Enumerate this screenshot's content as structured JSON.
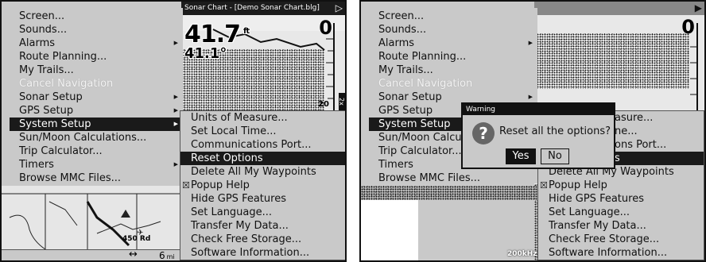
{
  "main_menu": [
    {
      "label": "Screen...",
      "arrow": false,
      "state": "normal"
    },
    {
      "label": "Sounds...",
      "arrow": false,
      "state": "normal"
    },
    {
      "label": "Alarms",
      "arrow": true,
      "state": "normal"
    },
    {
      "label": "Route Planning...",
      "arrow": false,
      "state": "normal"
    },
    {
      "label": "My Trails...",
      "arrow": false,
      "state": "normal"
    },
    {
      "label": "Cancel Navigation",
      "arrow": false,
      "state": "disabled"
    },
    {
      "label": "Sonar Setup",
      "arrow": true,
      "state": "normal"
    },
    {
      "label": "GPS Setup",
      "arrow": true,
      "state": "normal"
    },
    {
      "label": "System Setup",
      "arrow": true,
      "state": "selected"
    },
    {
      "label": "Sun/Moon Calculations...",
      "arrow": false,
      "state": "normal"
    },
    {
      "label": "Trip Calculator...",
      "arrow": false,
      "state": "normal"
    },
    {
      "label": "Timers",
      "arrow": true,
      "state": "normal"
    },
    {
      "label": "Browse MMC Files...",
      "arrow": false,
      "state": "normal"
    }
  ],
  "right_main_menu_labels": [
    "Screen...",
    "Sounds...",
    "Alarms",
    "Route Planning...",
    "My Trails...",
    "Cancel Navigation",
    "Sonar Setup",
    "GPS Setup",
    "System Setup",
    "Sun/Moon Calcu",
    "Trip Calculator...",
    "Timers",
    "Browse MMC Files..."
  ],
  "system_setup_menu": [
    {
      "label": "Units of Measure...",
      "checked": false
    },
    {
      "label": "Set Local Time...",
      "checked": false
    },
    {
      "label": "Communications Port...",
      "checked": false
    },
    {
      "label": "Reset Options",
      "checked": false
    },
    {
      "label": "Delete All My Waypoints",
      "checked": false
    },
    {
      "label": "Popup Help",
      "checked": true
    },
    {
      "label": "Hide GPS Features",
      "checked": false
    },
    {
      "label": "Set Language...",
      "checked": false
    },
    {
      "label": "Transfer My Data...",
      "checked": false
    },
    {
      "label": "Check Free Storage...",
      "checked": false
    },
    {
      "label": "Software Information...",
      "checked": false
    }
  ],
  "right_submenu_labels": [
    "asure...",
    "ne...",
    "ons Port...",
    "s",
    "Delete All My Waypoints",
    "Popup Help",
    "Hide GPS Features",
    "Set Language...",
    "Transfer My Data...",
    "Check Free Storage...",
    "Software Information..."
  ],
  "sonar": {
    "title": "Sonar Chart - [Demo Sonar Chart.blg]",
    "depth": "41.7",
    "depth_unit": "ft",
    "temperature": "41.1°",
    "scale_top": "0",
    "scale_bottom": "20",
    "zoom": "2x",
    "frequency": "200kHz"
  },
  "map": {
    "road_label": "450 Rd",
    "zoom_value": "6",
    "zoom_unit": "mi"
  },
  "dialog": {
    "title": "Warning",
    "message": "Reset all the options?",
    "yes_label": "Yes",
    "no_label": "No"
  },
  "colors": {
    "menu_bg": "#c9c9c9",
    "highlight": "#1a1a1a"
  }
}
